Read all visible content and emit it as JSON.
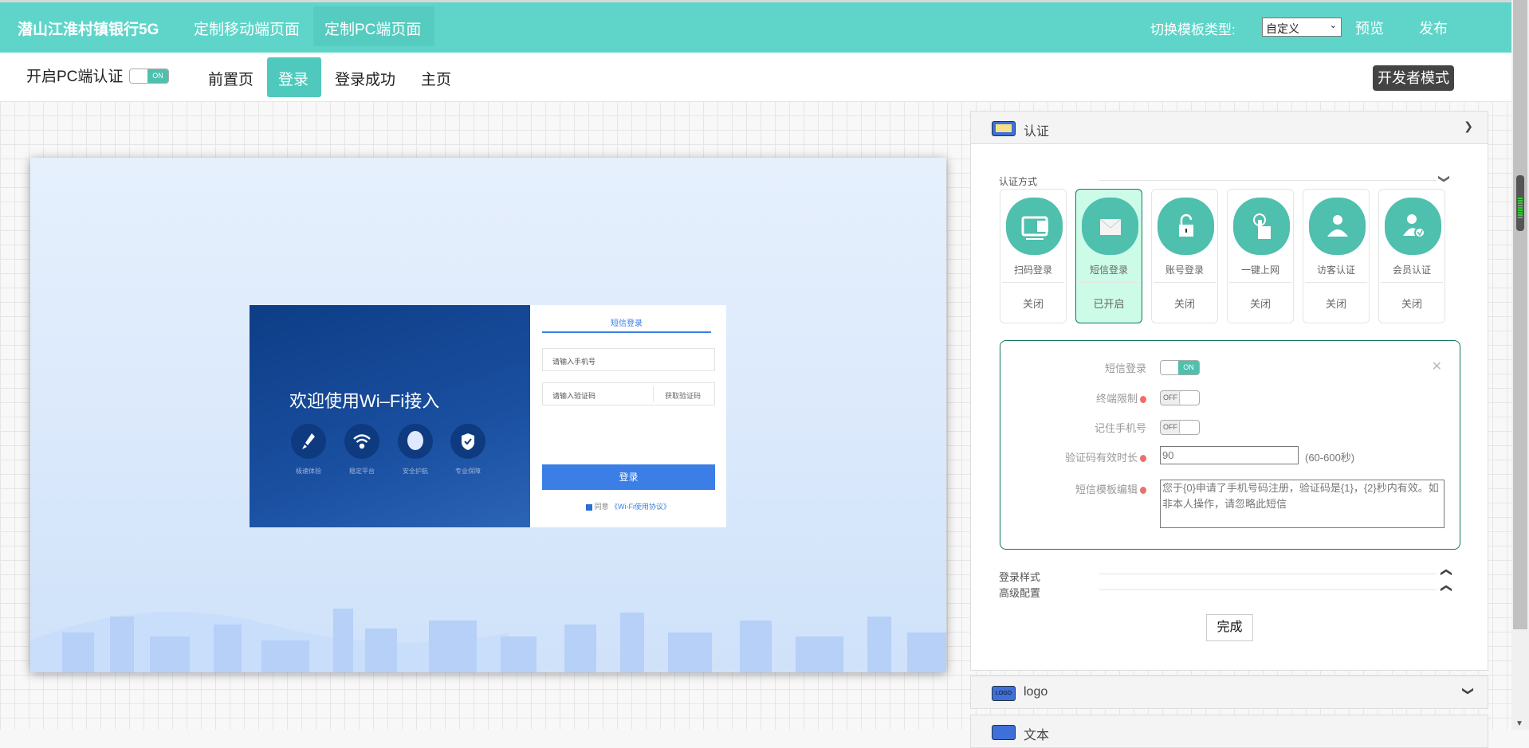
{
  "topbar": {
    "brand": "潜山江淮村镇银行5G",
    "tabs": [
      {
        "label": "定制移动端页面"
      },
      {
        "label": "定制PC端页面"
      }
    ],
    "template_label": "切换模板类型:",
    "template_value": "自定义",
    "preview": "预览",
    "publish": "发布"
  },
  "subnav": {
    "pc_auth_label": "开启PC端认证",
    "pc_auth_toggle": "ON",
    "pages": [
      {
        "label": "前置页"
      },
      {
        "label": "登录"
      },
      {
        "label": "登录成功"
      },
      {
        "label": "主页"
      }
    ],
    "dev_mode": "开发者模式"
  },
  "preview": {
    "welcome": "欢迎使用Wi–Fi接入",
    "features": [
      {
        "label": "极速体验",
        "icon": "rocket-icon"
      },
      {
        "label": "稳定平台",
        "icon": "wifi-icon"
      },
      {
        "label": "安全护航",
        "icon": "support-icon"
      },
      {
        "label": "专业保障",
        "icon": "shield-icon"
      }
    ],
    "tab": "短信登录",
    "phone_placeholder": "请输入手机号",
    "code_placeholder": "请输入验证码",
    "get_code": "获取验证码",
    "login": "登录",
    "agree": "同意",
    "agreement": "《Wi-Fi使用协议》"
  },
  "panel": {
    "title": "认证",
    "auth_methods_label": "认证方式",
    "methods": [
      {
        "name": "扫码登录",
        "status": "关闭"
      },
      {
        "name": "短信登录",
        "status": "已开启"
      },
      {
        "name": "账号登录",
        "status": "关闭"
      },
      {
        "name": "一键上网",
        "status": "关闭"
      },
      {
        "name": "访客认证",
        "status": "关闭"
      },
      {
        "name": "会员认证",
        "status": "关闭"
      }
    ],
    "sms": {
      "enable_label": "短信登录",
      "enable": "ON",
      "terminal_label": "终端限制",
      "terminal": "OFF",
      "remember_label": "记住手机号",
      "remember": "OFF",
      "expiry_label": "验证码有效时长",
      "expiry": "90",
      "expiry_range": "(60-600秒)",
      "template_label": "短信模板编辑",
      "template": "您于{0}申请了手机号码注册，验证码是{1}，{2}秒内有效。如非本人操作，请忽略此短信"
    },
    "sections": [
      {
        "label": "登录样式"
      },
      {
        "label": "高级配置"
      }
    ],
    "done": "完成"
  },
  "headers": [
    {
      "label": "logo",
      "icon_text": "LOGO"
    },
    {
      "label": "文本"
    }
  ],
  "colors": {
    "accent": "#5fd5c9",
    "teal": "#4fbfae",
    "blue": "#3a7ee6"
  }
}
